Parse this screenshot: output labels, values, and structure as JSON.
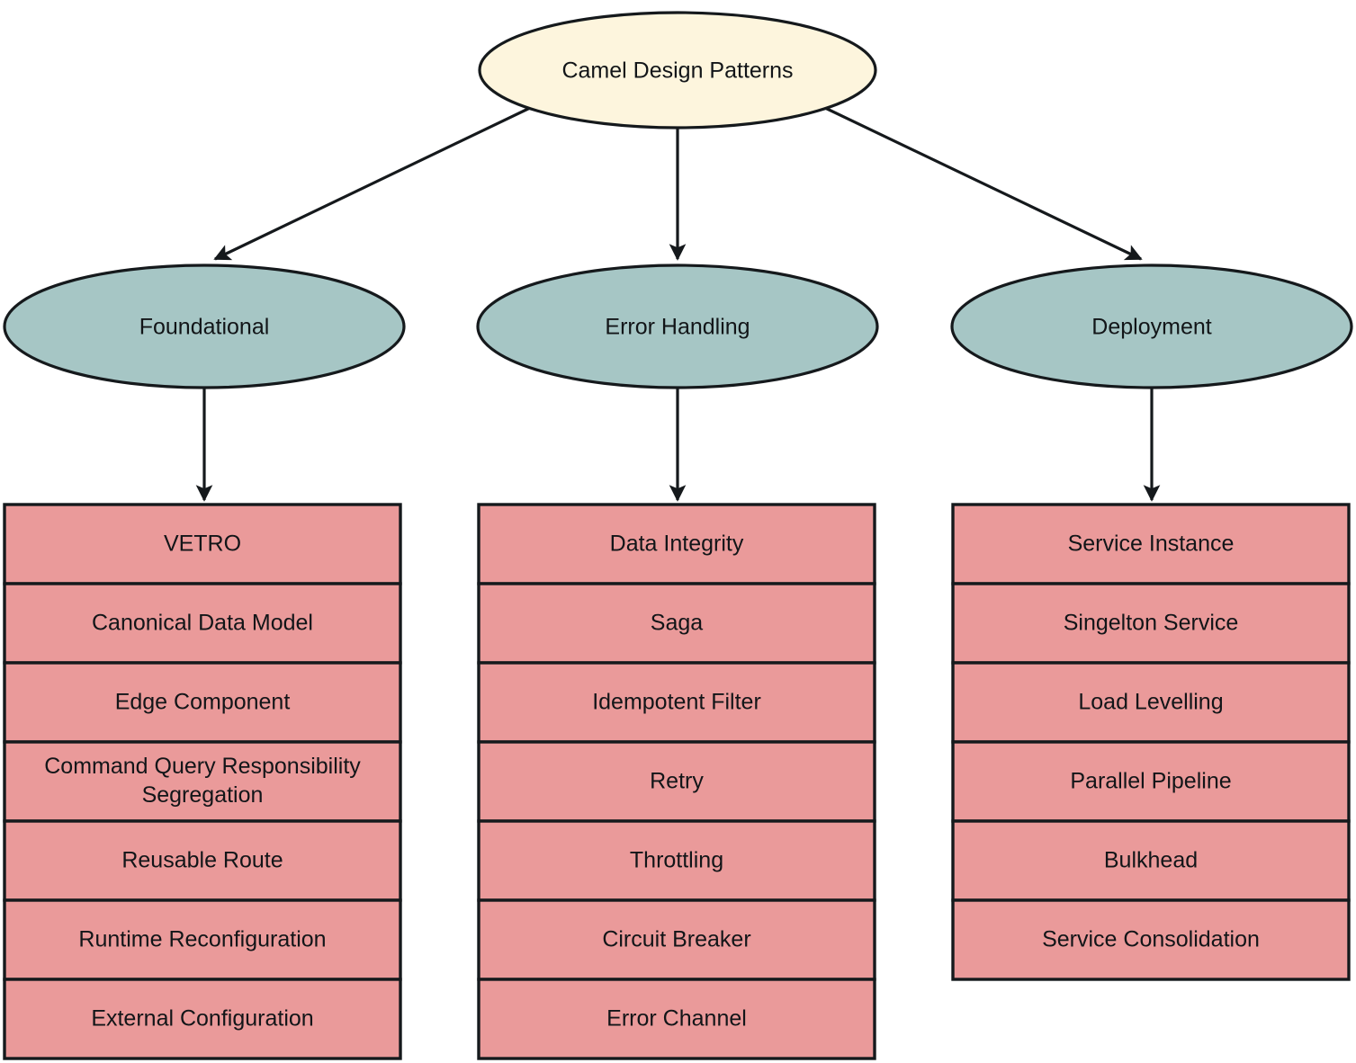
{
  "diagram": {
    "title": "Camel Design Patterns",
    "type": "flowchart",
    "root": {
      "id": "root",
      "label": "Camel Design Patterns",
      "shape": "ellipse",
      "fill": "#fdf5dd",
      "stroke": "#15191c"
    },
    "categories": [
      {
        "id": "foundational",
        "label": "Foundational",
        "shape": "ellipse",
        "fill": "#a6c6c5",
        "stroke": "#15191c",
        "patterns": [
          "VETRO",
          "Canonical Data Model",
          "Edge Component",
          "Command Query Responsibility Segregation",
          "Reusable Route",
          "Runtime Reconfiguration",
          "External Configuration"
        ]
      },
      {
        "id": "error-handling",
        "label": "Error Handling",
        "shape": "ellipse",
        "fill": "#a6c6c5",
        "stroke": "#15191c",
        "patterns": [
          "Data Integrity",
          "Saga",
          "Idempotent Filter",
          "Retry",
          "Throttling",
          "Circuit Breaker",
          "Error Channel"
        ]
      },
      {
        "id": "deployment",
        "label": "Deployment",
        "shape": "ellipse",
        "fill": "#a6c6c5",
        "stroke": "#15191c",
        "patterns": [
          "Service Instance",
          "Singelton Service",
          "Load Levelling",
          "Parallel Pipeline",
          "Bulkhead",
          "Service Consolidation"
        ]
      }
    ],
    "pattern_box_fill": "#ea9a9a",
    "pattern_box_stroke": "#15191c",
    "edge_color": "#15191c",
    "background": "#ffffff"
  }
}
